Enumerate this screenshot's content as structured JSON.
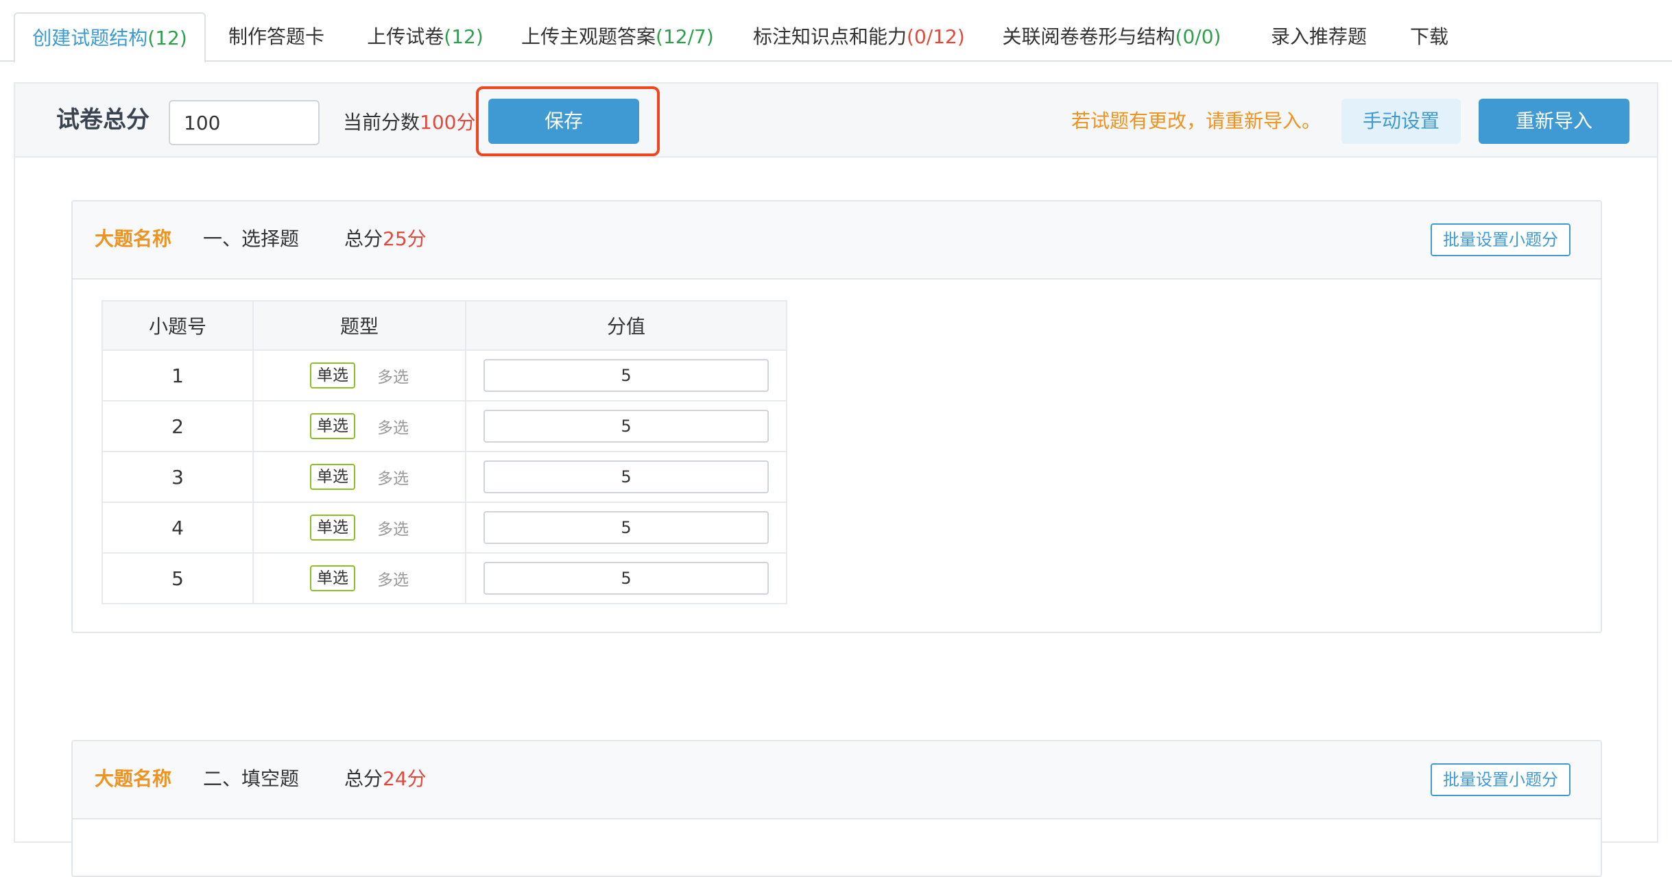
{
  "tabs": [
    {
      "label": "创建试题结构",
      "count": "(12)",
      "count_status": "ok",
      "active": true
    },
    {
      "label": "制作答题卡",
      "count": "",
      "count_status": "",
      "active": false
    },
    {
      "label": "上传试卷",
      "count": "(12)",
      "count_status": "ok",
      "active": false
    },
    {
      "label": "上传主观题答案",
      "count": "(12/7)",
      "count_status": "ok",
      "active": false
    },
    {
      "label": "标注知识点和能力",
      "count": "(0/12)",
      "count_status": "bad",
      "active": false
    },
    {
      "label": "关联阅卷卷形与结构",
      "count": "(0/0)",
      "count_status": "ok",
      "active": false
    },
    {
      "label": "录入推荐题",
      "count": "",
      "count_status": "",
      "active": false
    },
    {
      "label": "下载",
      "count": "",
      "count_status": "",
      "active": false
    }
  ],
  "toolbar": {
    "total_label": "试卷总分",
    "total_value": "100",
    "current_prefix": "当前分数",
    "current_value": "100分",
    "save_label": "保存",
    "warning": "若试题有更改，请重新导入。",
    "manual_label": "手动设置",
    "reimport_label": "重新导入"
  },
  "sections": [
    {
      "name_label": "大题名称",
      "name": "一、选择题",
      "total_prefix": "总分",
      "total_value": "25分",
      "batch_label": "批量设置小题分",
      "columns": [
        "小题号",
        "题型",
        "分值"
      ],
      "rows": [
        {
          "no": "1",
          "type_selected": "单选",
          "type_other": "多选",
          "score": "5"
        },
        {
          "no": "2",
          "type_selected": "单选",
          "type_other": "多选",
          "score": "5"
        },
        {
          "no": "3",
          "type_selected": "单选",
          "type_other": "多选",
          "score": "5"
        },
        {
          "no": "4",
          "type_selected": "单选",
          "type_other": "多选",
          "score": "5"
        },
        {
          "no": "5",
          "type_selected": "单选",
          "type_other": "多选",
          "score": "5"
        }
      ]
    },
    {
      "name_label": "大题名称",
      "name": "二、填空题",
      "total_prefix": "总分",
      "total_value": "24分",
      "batch_label": "批量设置小题分"
    }
  ],
  "colors": {
    "accent": "#3f9ad4",
    "warning": "#f0921e",
    "danger": "#e14a3b",
    "success": "#2e9f4b",
    "highlight": "#f0461e"
  }
}
